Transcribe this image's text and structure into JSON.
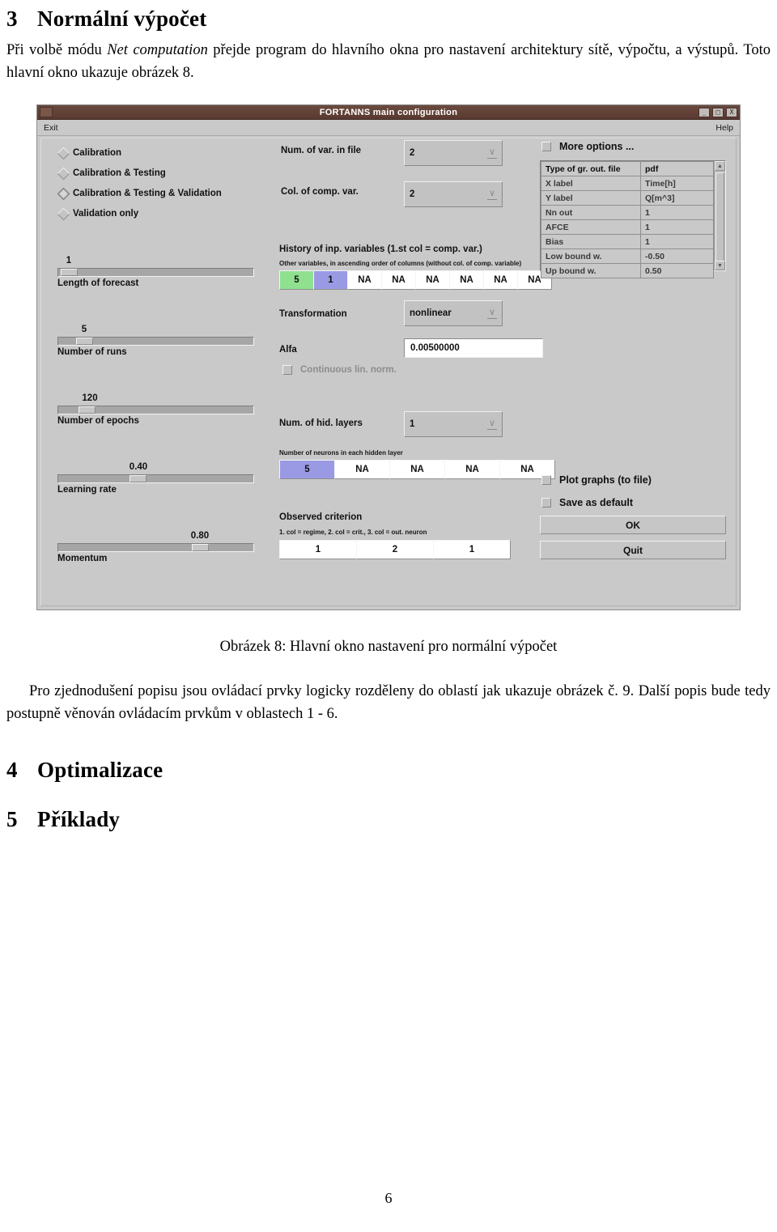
{
  "document": {
    "section3": {
      "number": "3",
      "title": "Normální výpočet"
    },
    "para1_a": "Při volbě módu ",
    "para1_em": "Net computation",
    "para1_b": " přejde program do hlavního okna pro nastavení architektury sítě, výpočtu, a výstupů. Toto hlavní okno ukazuje obrázek 8.",
    "figure_caption": "Obrázek 8: Hlavní okno nastavení pro normální výpočet",
    "para2": "Pro zjednodušení popisu jsou ovládací prvky logicky rozděleny do oblastí jak ukazuje obrázek č. 9. Další popis bude tedy postupně věnován ovládacím prvkům v oblastech 1 - 6.",
    "section4": {
      "number": "4",
      "title": "Optimalizace"
    },
    "section5": {
      "number": "5",
      "title": "Příklady"
    },
    "page_number": "6"
  },
  "app": {
    "title": "FORTANNS main configuration",
    "window_buttons": {
      "minimize": "_",
      "maximize": "□",
      "close": "X"
    },
    "menu": {
      "exit": "Exit",
      "help": "Help"
    },
    "colors": {
      "titlebar": "#5a3a30",
      "face": "#c9c9c9",
      "cell_green": "#8fe08f",
      "cell_blue": "#9a9ae4"
    },
    "modes": [
      {
        "label": "Calibration",
        "selected": false
      },
      {
        "label": "Calibration & Testing",
        "selected": false
      },
      {
        "label": "Calibration & Testing & Validation",
        "selected": true
      },
      {
        "label": "Validation only",
        "selected": false
      }
    ],
    "sliders": [
      {
        "name": "Length of forecast",
        "value": "1",
        "pct": 5
      },
      {
        "name": "Number of runs",
        "value": "5",
        "pct": 13
      },
      {
        "name": "Number of epochs",
        "value": "120",
        "pct": 14
      },
      {
        "name": "Learning rate",
        "value": "0.40",
        "pct": 38
      },
      {
        "name": "Momentum",
        "value": "0.80",
        "pct": 76
      }
    ],
    "center": {
      "num_var_label": "Num. of var. in file",
      "num_var_value": "2",
      "col_comp_label": "Col. of comp. var.",
      "col_comp_value": "2",
      "history_title": "History of inp. variables (1.st col = comp. var.)",
      "history_sub": "Other variables, in ascending order of columns (without col. of comp. variable)",
      "history_cells": [
        {
          "value": "5",
          "style": "green"
        },
        {
          "value": "1",
          "style": "blue"
        },
        {
          "value": "NA",
          "style": ""
        },
        {
          "value": "NA",
          "style": ""
        },
        {
          "value": "NA",
          "style": ""
        },
        {
          "value": "NA",
          "style": ""
        },
        {
          "value": "NA",
          "style": ""
        },
        {
          "value": "NA",
          "style": ""
        }
      ],
      "transformation_label": "Transformation",
      "transformation_value": "nonlinear",
      "alfa_label": "Alfa",
      "alfa_value": "0.00500000",
      "continuous_label": "Continuous lin. norm.",
      "hid_layers_label": "Num. of hid. layers",
      "hid_layers_value": "1",
      "neurons_sub": "Number of neurons in each hidden layer",
      "neuron_cells": [
        {
          "value": "5",
          "style": "blue"
        },
        {
          "value": "NA",
          "style": ""
        },
        {
          "value": "NA",
          "style": ""
        },
        {
          "value": "NA",
          "style": ""
        },
        {
          "value": "NA",
          "style": ""
        }
      ],
      "criterion_title": "Observed criterion",
      "criterion_sub": "1. col = regime, 2. col = crit., 3. col = out. neuron",
      "criterion_cells": [
        "1",
        "2",
        "1"
      ]
    },
    "right": {
      "more_options_label": "More options ...",
      "options_rows": [
        {
          "key": "Type of gr. out. file",
          "value": "pdf"
        },
        {
          "key": "X label",
          "value": "Time[h]"
        },
        {
          "key": "Y label",
          "value": "Q[m^3]"
        },
        {
          "key": "Nn out",
          "value": "1"
        },
        {
          "key": "AFCE",
          "value": "1"
        },
        {
          "key": "Bias",
          "value": "1"
        },
        {
          "key": "Low bound w.",
          "value": "-0.50"
        },
        {
          "key": "Up bound w.",
          "value": "0.50"
        }
      ],
      "scroll_up": "▲",
      "scroll_down": "▼",
      "plot_graphs_label": "Plot graphs (to file)",
      "save_default_label": "Save as default",
      "ok_label": "OK",
      "quit_label": "Quit"
    }
  }
}
